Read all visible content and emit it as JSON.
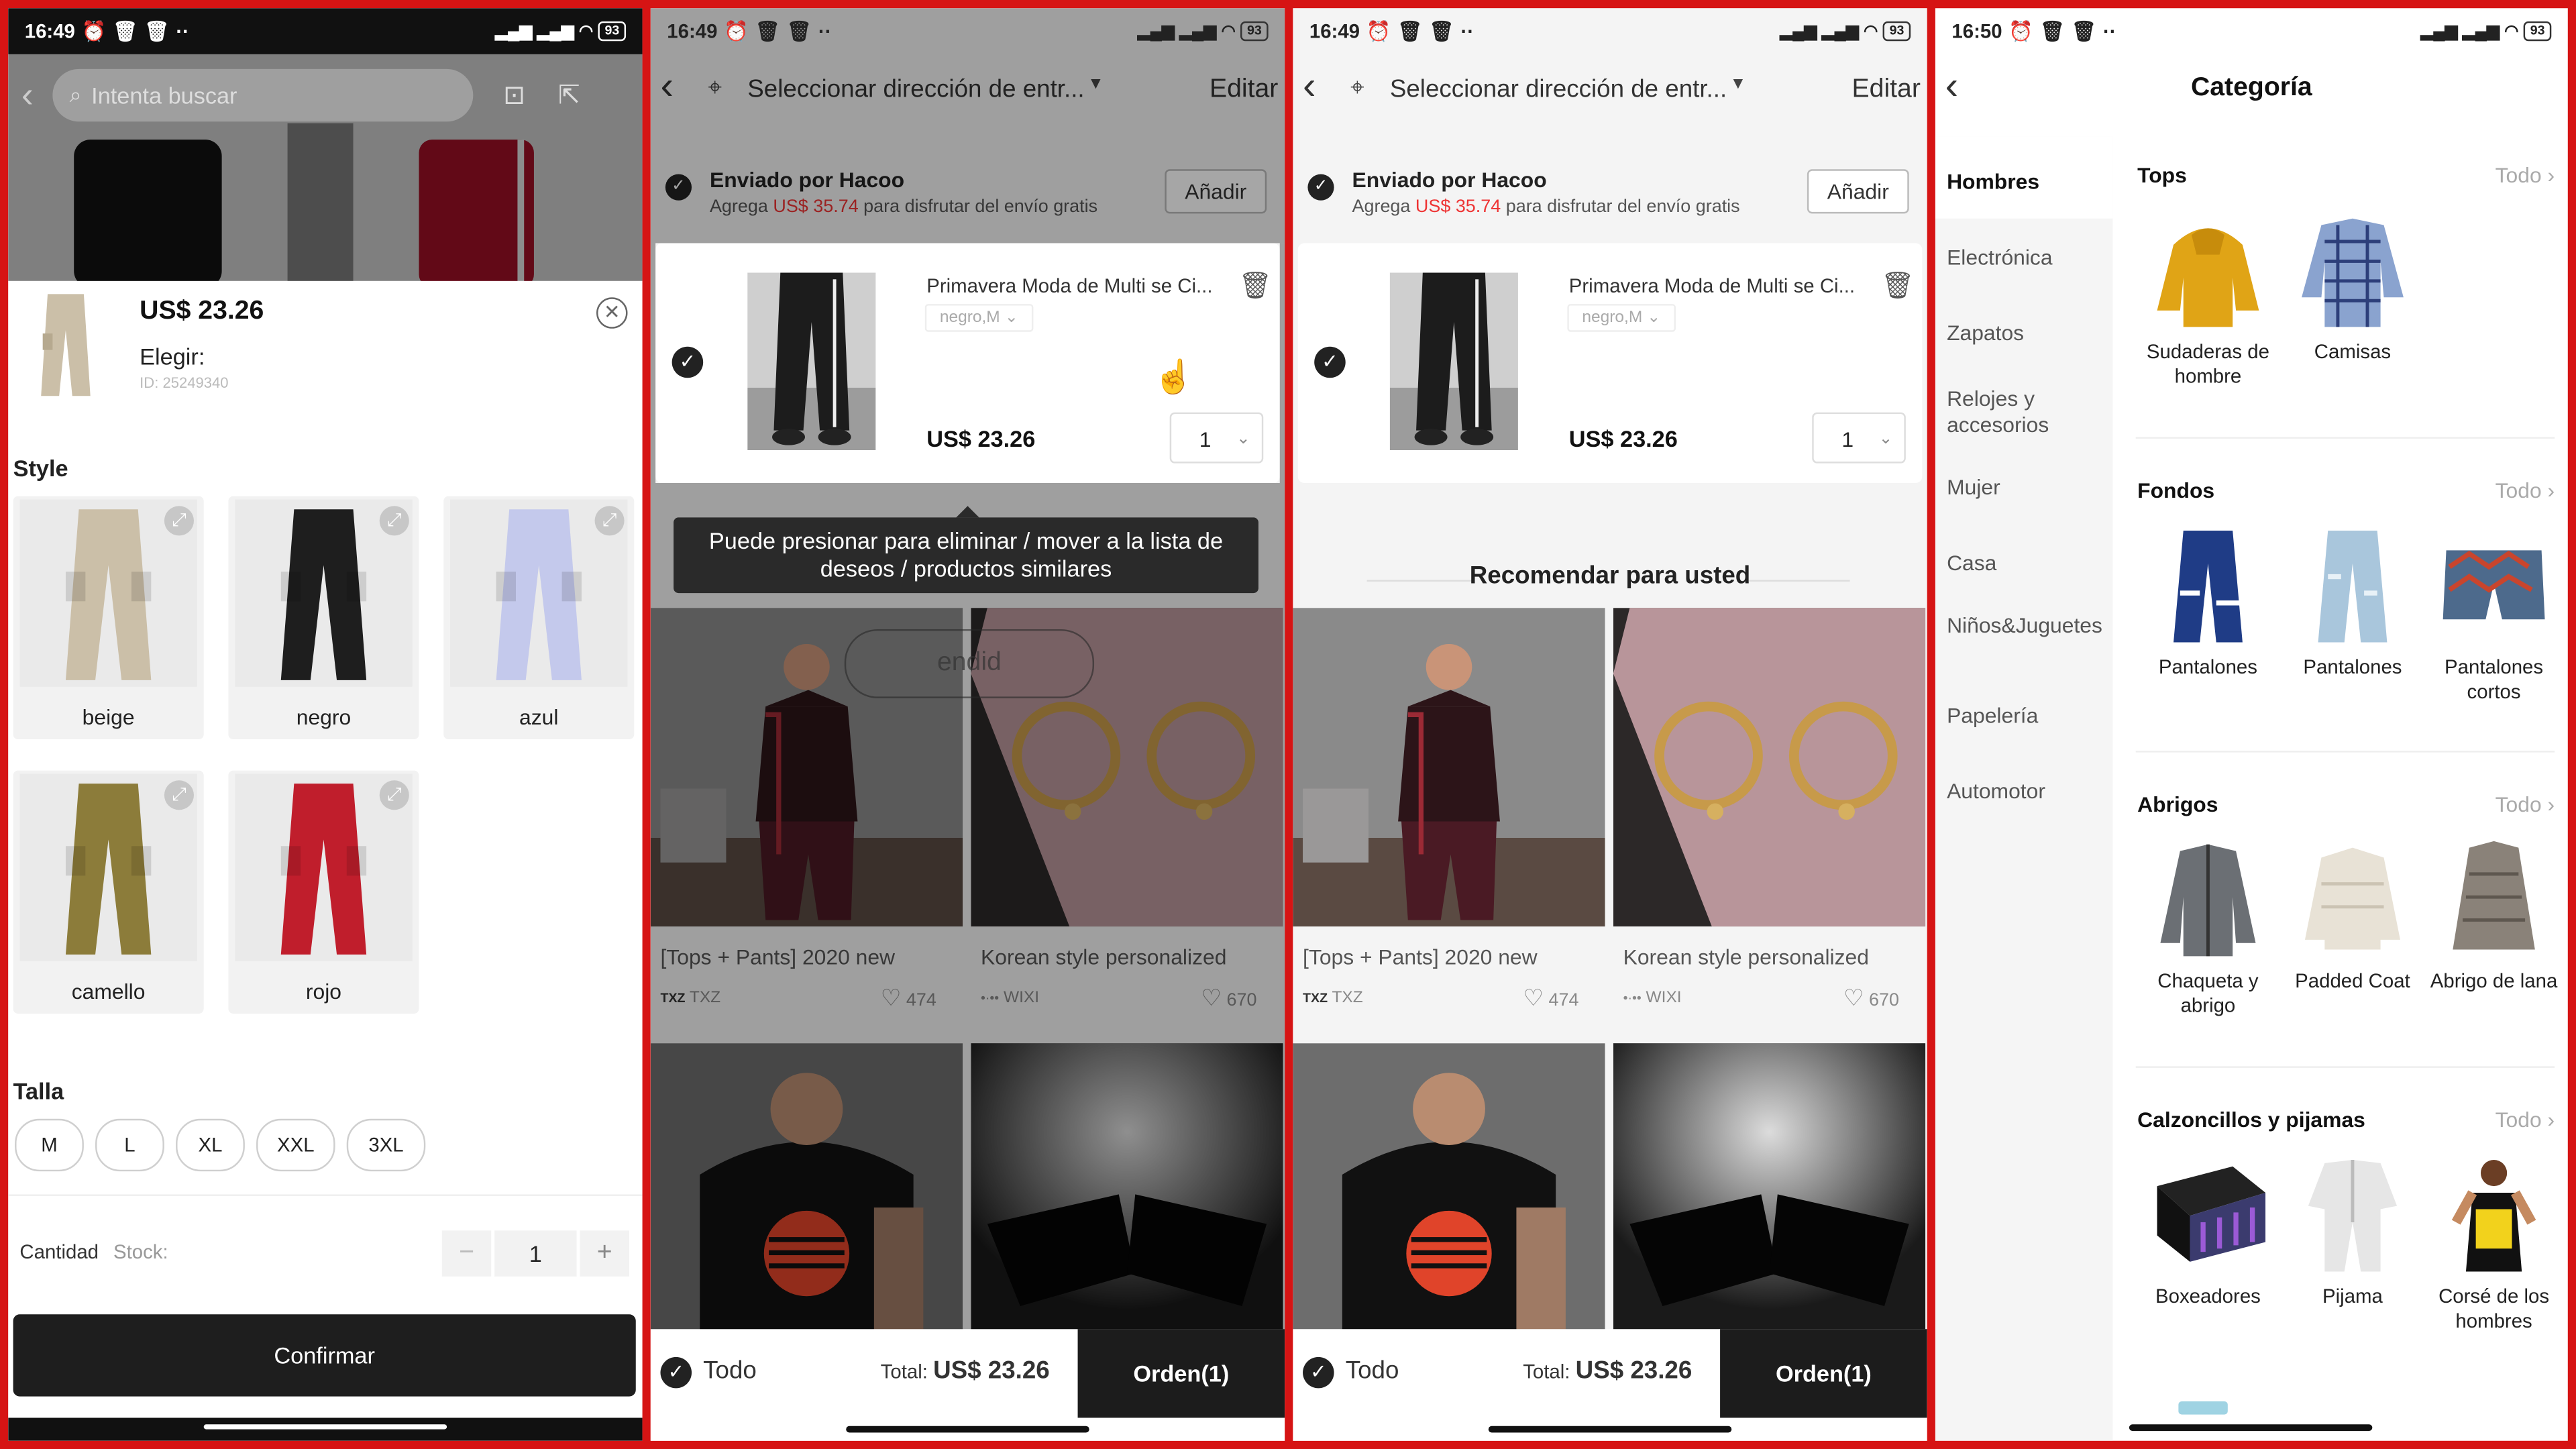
{
  "screens": [
    {
      "status": {
        "time": "16:49",
        "dots": "··",
        "battery": "93"
      },
      "search": {
        "placeholder": "Intenta buscar"
      },
      "product": {
        "price": "US$ 23.26",
        "choose": "Elegir:",
        "id": "ID: 25249340"
      },
      "style_label": "Style",
      "swatches": [
        {
          "label": "beige",
          "color": "#cbbfa8"
        },
        {
          "label": "negro",
          "color": "#1e1e1e"
        },
        {
          "label": "azul",
          "color": "#c4c9ec"
        },
        {
          "label": "camello",
          "color": "#8c7c3a"
        },
        {
          "label": "rojo",
          "color": "#c01e2c"
        }
      ],
      "talla_label": "Talla",
      "sizes": [
        "M",
        "L",
        "XL",
        "XXL",
        "3XL"
      ],
      "cantidad_label": "Cantidad",
      "stock_label": "Stock:",
      "quantity": "1",
      "confirm_label": "Confirmar"
    },
    {
      "status": {
        "time": "16:49",
        "dots": "··",
        "battery": "93"
      },
      "header": {
        "title": "Seleccionar dirección de entr...",
        "edit": "Editar"
      },
      "shipping": {
        "title": "Enviado por Hacoo",
        "note_prefix": "Agrega",
        "note_amount": "US$ 35.74",
        "note_suffix": "para disfrutar del envío gratis",
        "add": "Añadir"
      },
      "cart_item": {
        "title": "Primavera Moda de Multi se Ci...",
        "variant": "negro,M",
        "price": "US$ 23.26",
        "qty": "1"
      },
      "tooltip": "Puede presionar para eliminar / mover a la lista de deseos / productos similares",
      "ghost_text": "endid",
      "products": [
        {
          "title": "[Tops + Pants] 2020 new",
          "brand": "TXZ",
          "likes": "474"
        },
        {
          "title": "Korean style personalized",
          "brand": "WIXI",
          "likes": "670"
        }
      ],
      "footer": {
        "all": "Todo",
        "total_label": "Total:",
        "total": "US$ 23.26",
        "order": "Orden(1)"
      }
    },
    {
      "status": {
        "time": "16:49",
        "dots": "··",
        "battery": "93"
      },
      "header": {
        "title": "Seleccionar dirección de entr...",
        "edit": "Editar"
      },
      "shipping": {
        "title": "Enviado por Hacoo",
        "note_prefix": "Agrega",
        "note_amount": "US$ 35.74",
        "note_suffix": "para disfrutar del envío gratis",
        "add": "Añadir"
      },
      "cart_item": {
        "title": "Primavera Moda de Multi se Ci...",
        "variant": "negro,M",
        "price": "US$ 23.26",
        "qty": "1"
      },
      "recommend": "Recomendar para usted",
      "products": [
        {
          "title": "[Tops + Pants] 2020 new",
          "brand": "TXZ",
          "likes": "474"
        },
        {
          "title": "Korean style personalized",
          "brand": "WIXI",
          "likes": "670"
        }
      ],
      "footer": {
        "all": "Todo",
        "total_label": "Total:",
        "total": "US$ 23.26",
        "order": "Orden(1)"
      }
    },
    {
      "status": {
        "time": "16:50",
        "dots": "··",
        "battery": "93"
      },
      "title": "Categoría",
      "sidebar": [
        "Hombres",
        "Electrónica",
        "Zapatos",
        "Relojes y accesorios",
        "Mujer",
        "Casa",
        "Niños&Juguetes",
        "Papelería",
        "Automotor"
      ],
      "todo": "Todo",
      "sections": [
        {
          "title": "Tops",
          "items": [
            "Sudaderas de hombre",
            "Camisas"
          ]
        },
        {
          "title": "Fondos",
          "items": [
            "Pantalones",
            "Pantalones",
            "Pantalones cortos"
          ]
        },
        {
          "title": "Abrigos",
          "items": [
            "Chaqueta y abrigo",
            "Padded Coat",
            "Abrigo de lana"
          ]
        },
        {
          "title": "Calzoncillos y pijamas",
          "items": [
            "Boxeadores",
            "Pijama",
            "Corsé de los hombres"
          ]
        }
      ]
    }
  ]
}
